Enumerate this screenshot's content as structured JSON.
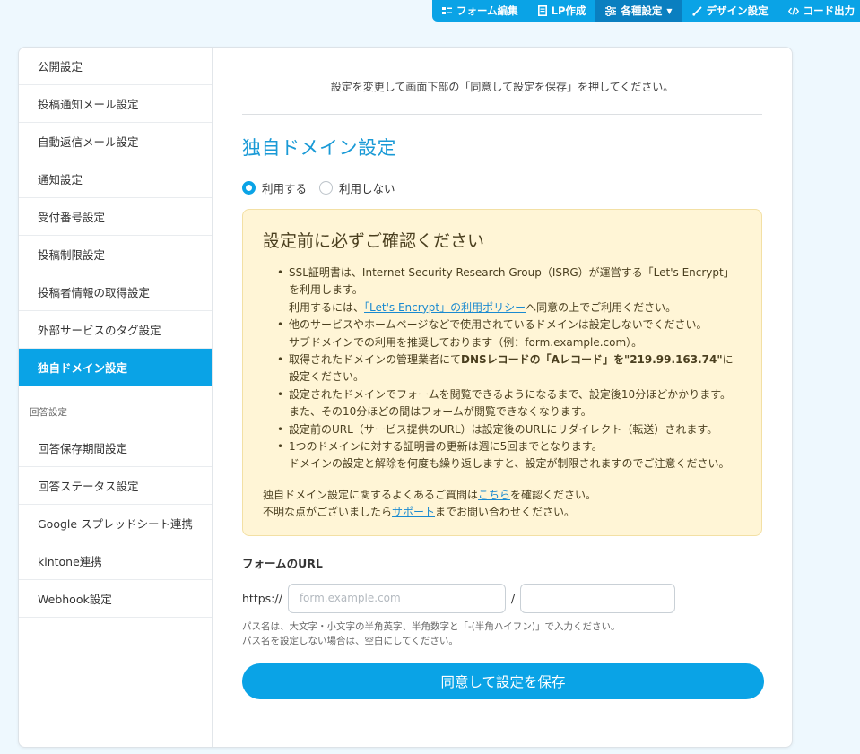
{
  "toolbar": {
    "items": [
      {
        "label": "フォーム編集",
        "icon": "form-edit-icon"
      },
      {
        "label": "LP作成",
        "icon": "document-icon"
      },
      {
        "label": "各種設定",
        "icon": "sliders-icon",
        "active": true
      },
      {
        "label": "デザイン設定",
        "icon": "brush-icon"
      },
      {
        "label": "コード出力",
        "icon": "code-icon"
      }
    ],
    "accent": "#0aa3e6"
  },
  "sidebar": {
    "items": [
      "公開設定",
      "投稿通知メール設定",
      "自動返信メール設定",
      "通知設定",
      "受付番号設定",
      "投稿制限設定",
      "投稿者情報の取得設定",
      "外部サービスのタグ設定",
      "独自ドメイン設定"
    ],
    "active_index": 8,
    "group_label": "回答設定",
    "group_items": [
      "回答保存期間設定",
      "回答ステータス設定",
      "Google スプレッドシート連携",
      "kintone連携",
      "Webhook設定"
    ]
  },
  "main": {
    "notice": "設定を変更して画面下部の「同意して設定を保存」を押してください。",
    "title": "独自ドメイン設定",
    "radio_use": "利用する",
    "radio_not_use": "利用しない",
    "selected": "利用する",
    "warning": {
      "title": "設定前に必ずご確認ください",
      "b1_line1": "SSL証明書は、Internet Security Research Group（ISRG）が運営する「Let's Encrypt」を利用します。",
      "b1_line2_pre": "利用するには、",
      "b1_link": "「Let's Encrypt」の利用ポリシー",
      "b1_line2_post": "へ同意の上でご利用ください。",
      "b2_line1": "他のサービスやホームページなどで使用されているドメインは設定しないでください。",
      "b2_line2": "サブドメインでの利用を推奨しております（例：form.example.com）。",
      "b3_pre": "取得されたドメインの管理業者にて",
      "b3_bold": "DNSレコードの「Aレコード」を\"219.99.163.74\"",
      "b3_post": "に設定ください。",
      "b4_line1": "設定されたドメインでフォームを閲覧できるようになるまで、設定後10分ほどかかります。",
      "b4_line2": "また、その10分ほどの間はフォームが閲覧できなくなります。",
      "b5": "設定前のURL（サービス提供のURL）は設定後のURLにリダイレクト（転送）されます。",
      "b6_line1": "1つのドメインに対する証明書の更新は週に5回までとなります。",
      "b6_line2": "ドメインの設定と解除を何度も繰り返しますと、設定が制限されますのでご注意ください。",
      "foot1_pre": "独自ドメイン設定に関するよくあるご質問は",
      "foot1_link": "こちら",
      "foot1_post": "を確認ください。",
      "foot2_pre": "不明な点がございましたら",
      "foot2_link": "サポート",
      "foot2_post": "までお問い合わせください。"
    },
    "url_label": "フォームのURL",
    "scheme": "https://",
    "domain_placeholder": "form.example.com",
    "domain_value": "",
    "separator": "/",
    "path_value": "",
    "hint1": "パス名は、大文字・小文字の半角英字、半角数字と「-(半角ハイフン)」で入力ください。",
    "hint2": "パス名を設定しない場合は、空白にしてください。",
    "save_label": "同意して設定を保存"
  }
}
